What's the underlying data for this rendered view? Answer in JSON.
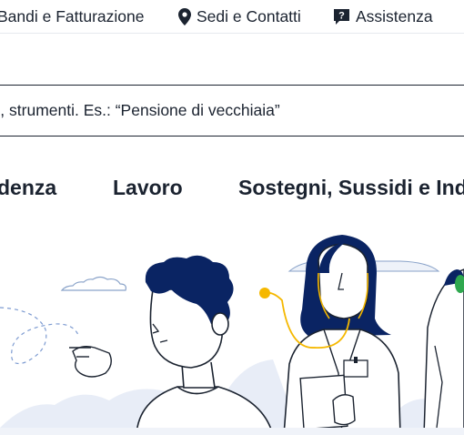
{
  "topbar": {
    "links": [
      {
        "label": "Bandi e Fatturazione",
        "icon": "none"
      },
      {
        "label": "Sedi e Contatti",
        "icon": "map-pin-icon"
      },
      {
        "label": "Assistenza",
        "icon": "help-chat-icon"
      }
    ]
  },
  "search": {
    "placeholder": "mazioni, strumenti. Es.: “Pensione di vecchiaia”"
  },
  "nav": {
    "items": [
      {
        "label": "denza"
      },
      {
        "label": "Lavoro"
      },
      {
        "label": "Sostegni, Sussidi e Inde"
      }
    ]
  },
  "colors": {
    "navy": "#0a2463",
    "text": "#1b2330",
    "accent_yellow": "#f5b800",
    "accent_green": "#2fa84f",
    "cloud": "#e3e9f5"
  }
}
